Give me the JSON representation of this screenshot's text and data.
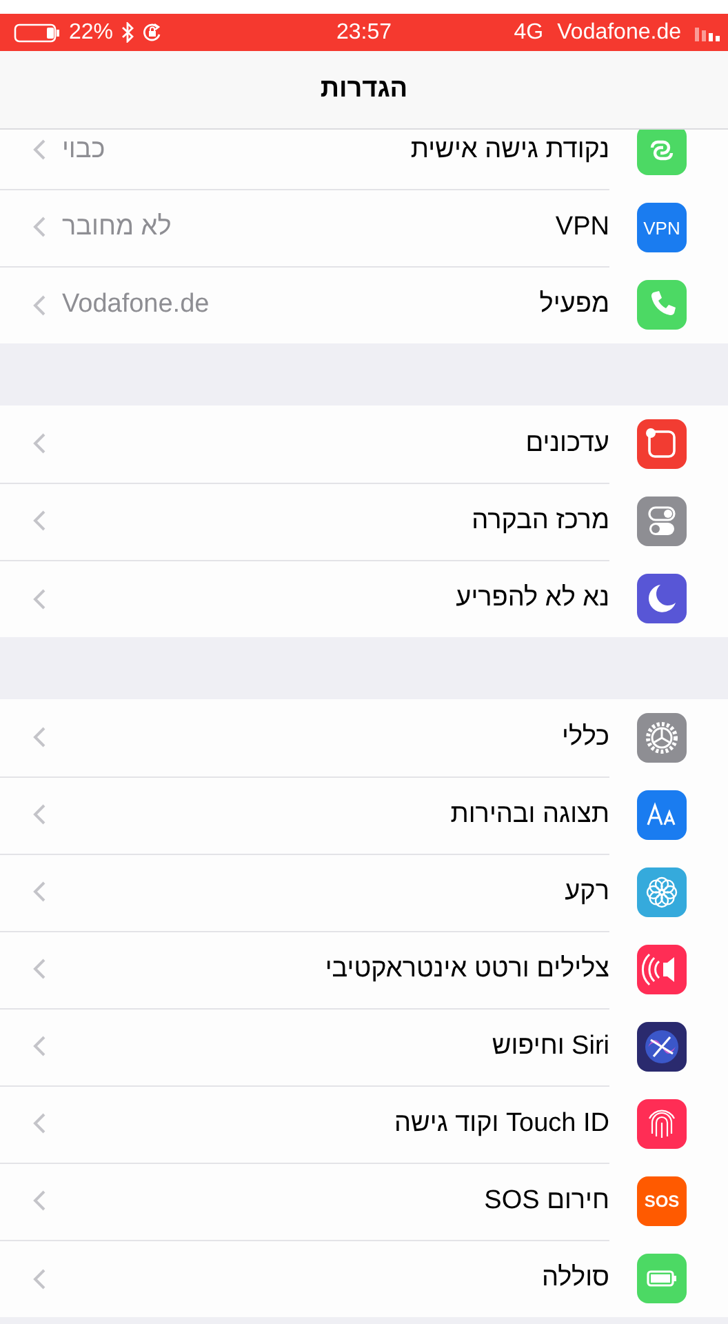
{
  "status_bar": {
    "battery": "22%",
    "time": "23:57",
    "network": "4G",
    "carrier": "Vodafone.de"
  },
  "nav": {
    "title": "הגדרות"
  },
  "groups": [
    {
      "rows": [
        {
          "kind": "hotspot",
          "label": "נקודת גישה אישית",
          "value": "כבוי"
        },
        {
          "kind": "vpn",
          "icon_text": "VPN",
          "label": "VPN",
          "value": "לא מחובר"
        },
        {
          "kind": "phone",
          "label": "מפעיל",
          "value": "Vodafone.de"
        }
      ]
    },
    {
      "rows": [
        {
          "kind": "notifications",
          "label": "עדכונים"
        },
        {
          "kind": "control",
          "label": "מרכז הבקרה"
        },
        {
          "kind": "moon",
          "label": "נא לא להפריע"
        }
      ]
    },
    {
      "rows": [
        {
          "kind": "gear",
          "label": "כללי"
        },
        {
          "kind": "display",
          "label": "תצוגה ובהירות"
        },
        {
          "kind": "flower",
          "label": "רקע"
        },
        {
          "kind": "sounds",
          "label": "צלילים ורטט אינטראקטיבי"
        },
        {
          "kind": "siri",
          "label": "Siri וחיפוש"
        },
        {
          "kind": "fingerprint",
          "label": "Touch ID וקוד גישה"
        },
        {
          "kind": "sos",
          "icon_text": "SOS",
          "label": "חירום SOS"
        },
        {
          "kind": "battery",
          "label": "סוללה"
        }
      ]
    }
  ]
}
